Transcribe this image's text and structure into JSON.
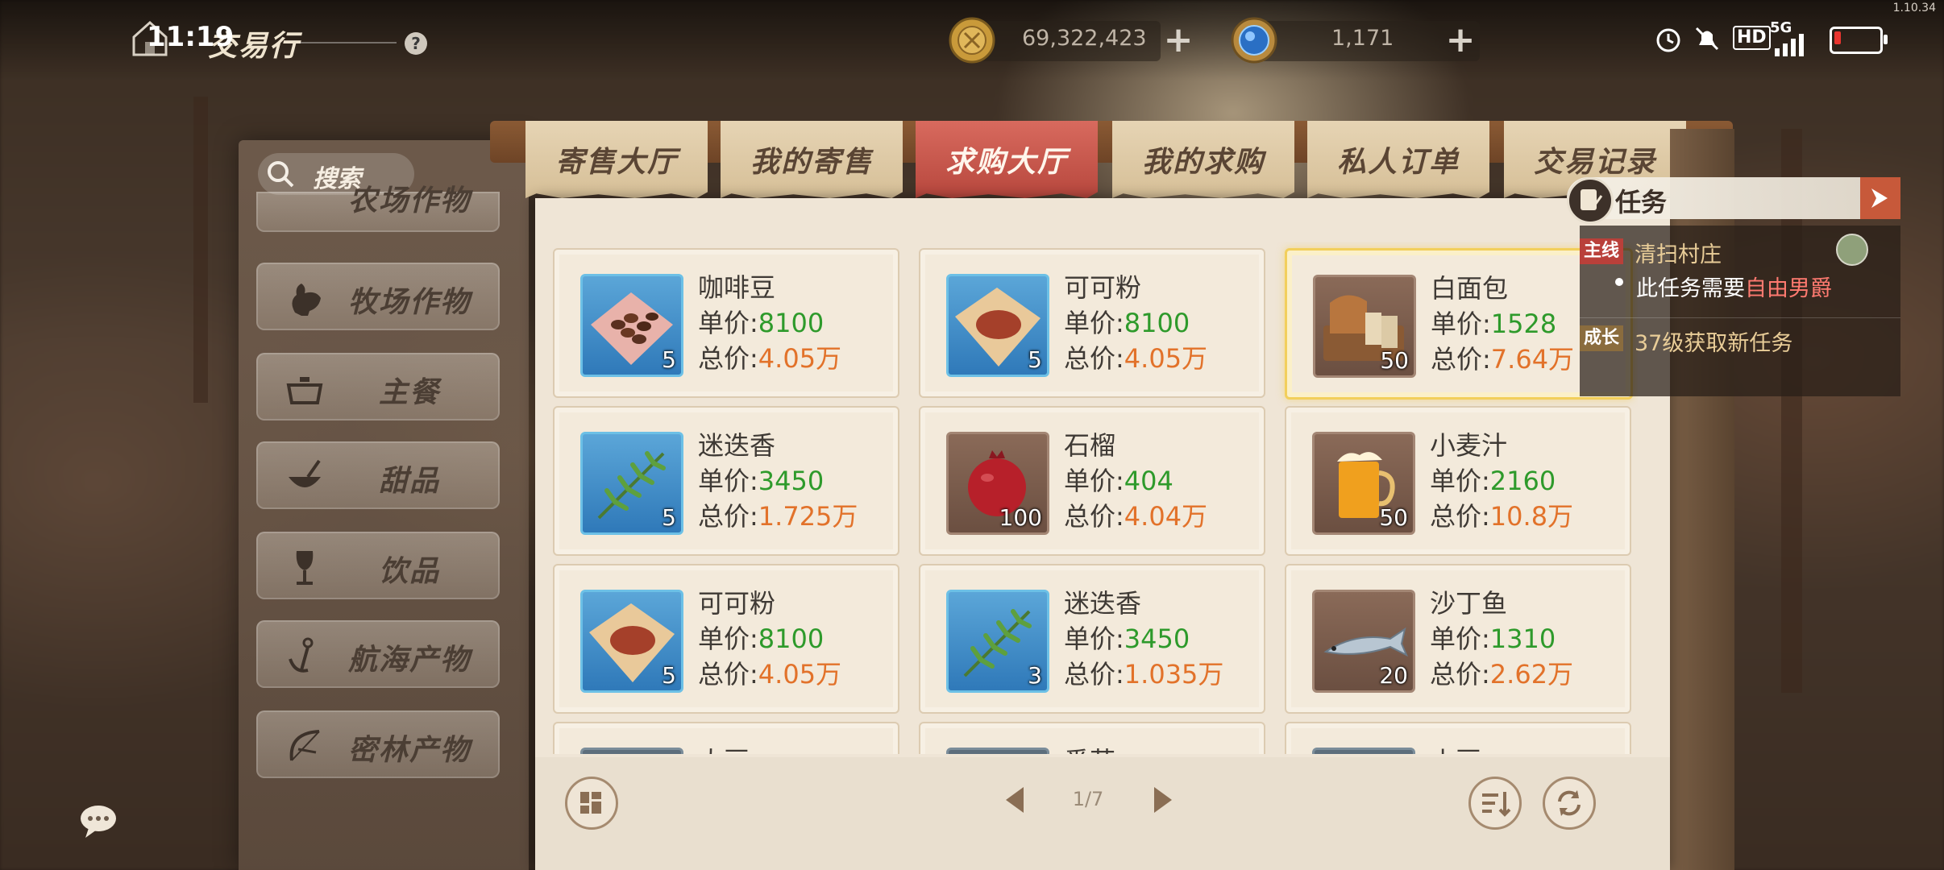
{
  "status_bar": {
    "time": "11:19",
    "version": "1.10.34",
    "network": "5G",
    "hd": "HD",
    "battery_level": 0.15
  },
  "header": {
    "title": "交易行",
    "help_label": "?"
  },
  "currencies": [
    {
      "name": "gold-coin-icon",
      "value": "69,322,423"
    },
    {
      "name": "blue-gem-icon",
      "value": "1,171"
    }
  ],
  "search": {
    "label": "搜索"
  },
  "categories": [
    {
      "label": "农场作物",
      "icon": "crop-icon"
    },
    {
      "label": "牧场作物",
      "icon": "rooster-icon"
    },
    {
      "label": "主餐",
      "icon": "pot-icon"
    },
    {
      "label": "甜品",
      "icon": "whisk-bowl-icon"
    },
    {
      "label": "饮品",
      "icon": "wine-glass-icon"
    },
    {
      "label": "航海产物",
      "icon": "anchor-icon"
    },
    {
      "label": "密林产物",
      "icon": "bow-icon"
    }
  ],
  "tabs": [
    {
      "label": "寄售大厅"
    },
    {
      "label": "我的寄售"
    },
    {
      "label": "求购大厅",
      "active": true
    },
    {
      "label": "我的求购"
    },
    {
      "label": "私人订单"
    },
    {
      "label": "交易记录"
    }
  ],
  "labels": {
    "unit_price": "单价:",
    "total_price": "总价:"
  },
  "items": [
    {
      "name": "咖啡豆",
      "unit_price": "8100",
      "total_price": "4.05万",
      "qty": "5",
      "icon": "coffee-beans-icon",
      "bg": "blue"
    },
    {
      "name": "可可粉",
      "unit_price": "8100",
      "total_price": "4.05万",
      "qty": "5",
      "icon": "cocoa-powder-icon",
      "bg": "blue"
    },
    {
      "name": "白面包",
      "unit_price": "1528",
      "total_price": "7.64万",
      "qty": "50",
      "icon": "white-bread-icon",
      "bg": "brown",
      "selected": true
    },
    {
      "name": "迷迭香",
      "unit_price": "3450",
      "total_price": "1.725万",
      "qty": "5",
      "icon": "rosemary-icon",
      "bg": "blue"
    },
    {
      "name": "石榴",
      "unit_price": "404",
      "total_price": "4.04万",
      "qty": "100",
      "icon": "pomegranate-icon",
      "bg": "brown"
    },
    {
      "name": "小麦汁",
      "unit_price": "2160",
      "total_price": "10.8万",
      "qty": "50",
      "icon": "beer-mug-icon",
      "bg": "brown"
    },
    {
      "name": "可可粉",
      "unit_price": "8100",
      "total_price": "4.05万",
      "qty": "5",
      "icon": "cocoa-powder-icon",
      "bg": "blue"
    },
    {
      "name": "迷迭香",
      "unit_price": "3450",
      "total_price": "1.035万",
      "qty": "3",
      "icon": "rosemary-icon",
      "bg": "blue"
    },
    {
      "name": "沙丁鱼",
      "unit_price": "1310",
      "total_price": "2.62万",
      "qty": "20",
      "icon": "sardine-icon",
      "bg": "brown"
    },
    {
      "name": "大豆",
      "unit_price": "",
      "total_price": "",
      "qty": "",
      "icon": "item-icon",
      "bg": "blue"
    },
    {
      "name": "番茄",
      "unit_price": "",
      "total_price": "",
      "qty": "",
      "icon": "item-icon",
      "bg": "blue"
    },
    {
      "name": "小豆",
      "unit_price": "",
      "total_price": "",
      "qty": "",
      "icon": "item-icon",
      "bg": "blue"
    }
  ],
  "pagination": {
    "page_text": "1/7"
  },
  "quest": {
    "title": "任务",
    "main_tag": "主线",
    "main_name": "清扫村庄",
    "requirement_prefix": "此任务需要",
    "requirement_rank": "自由男爵",
    "growth_tag": "成长",
    "growth_text": "37级获取新任务"
  }
}
